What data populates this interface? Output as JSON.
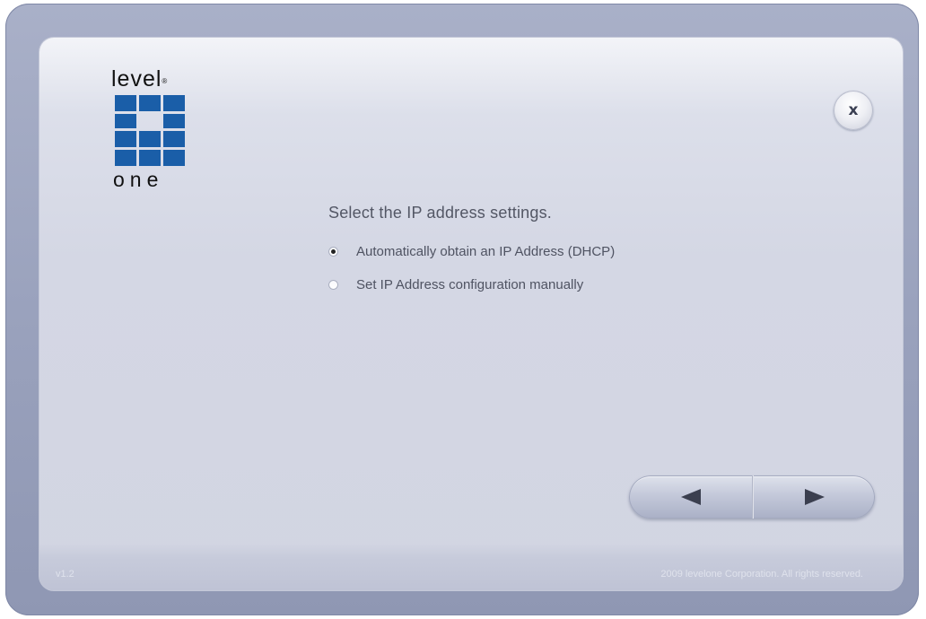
{
  "logo": {
    "top_text": "level",
    "registered_mark": "®",
    "bottom_text": "one",
    "grid_color": "#1a5ea8"
  },
  "close": {
    "label": "x",
    "icon": "close-icon"
  },
  "content": {
    "title": "Select the IP address settings.",
    "options": [
      {
        "label": "Automatically obtain an IP Address (DHCP)",
        "checked": true
      },
      {
        "label": "Set IP Address configuration manually",
        "checked": false
      }
    ]
  },
  "nav": {
    "back_icon": "triangle-left-icon",
    "next_icon": "triangle-right-icon"
  },
  "footer": {
    "version": "v1.2",
    "copyright": "2009 levelone Corporation. All rights reserved."
  },
  "colors": {
    "frame": "#9aa2bd",
    "panel": "#d4d7e4",
    "text": "#535765",
    "logo_blue": "#1a5ea8"
  }
}
